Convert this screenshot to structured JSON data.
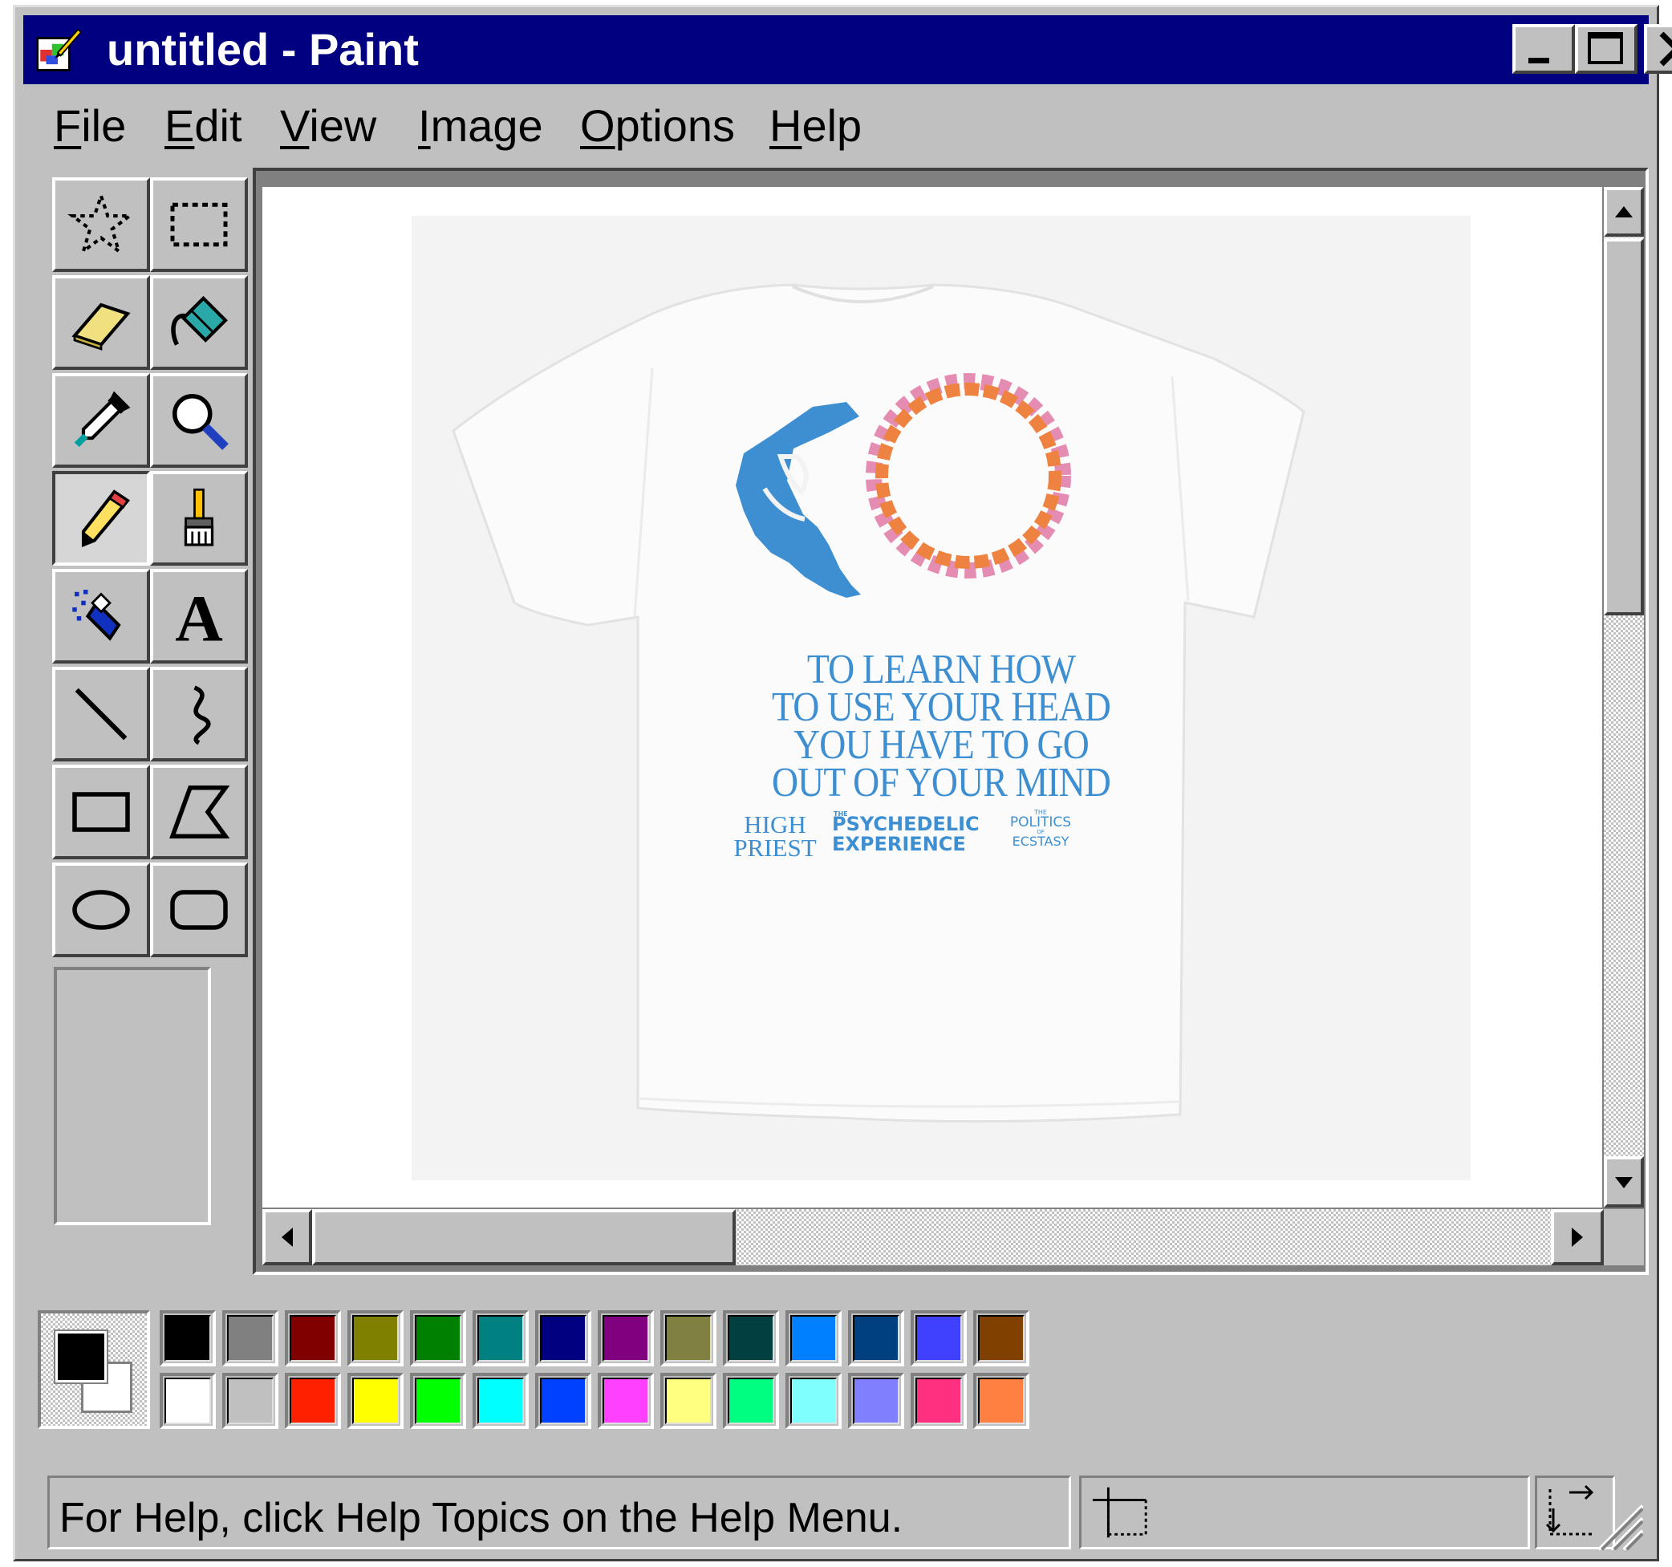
{
  "window": {
    "title": "untitled - Paint",
    "app_icon": "paint-app-icon",
    "controls": [
      "minimize-icon",
      "maximize-icon",
      "close-icon"
    ]
  },
  "menubar": {
    "items": [
      {
        "label": "File",
        "mnemonic": "F"
      },
      {
        "label": "Edit",
        "mnemonic": "E"
      },
      {
        "label": "View",
        "mnemonic": "V"
      },
      {
        "label": "Image",
        "mnemonic": "I"
      },
      {
        "label": "Options",
        "mnemonic": "O"
      },
      {
        "label": "Help",
        "mnemonic": "H"
      }
    ]
  },
  "toolbox": {
    "tools": [
      {
        "name": "free-form-select-icon"
      },
      {
        "name": "rectangle-select-icon"
      },
      {
        "name": "eraser-icon"
      },
      {
        "name": "fill-with-color-icon"
      },
      {
        "name": "pick-color-icon"
      },
      {
        "name": "magnifier-icon"
      },
      {
        "name": "pencil-icon",
        "selected": true
      },
      {
        "name": "brush-icon"
      },
      {
        "name": "airbrush-icon"
      },
      {
        "name": "text-icon"
      },
      {
        "name": "line-icon"
      },
      {
        "name": "curve-icon"
      },
      {
        "name": "rectangle-icon"
      },
      {
        "name": "polygon-icon"
      },
      {
        "name": "ellipse-icon"
      },
      {
        "name": "rounded-rectangle-icon"
      }
    ]
  },
  "canvas_image": {
    "quote": [
      "TO LEARN HOW",
      "TO USE YOUR HEAD",
      "YOU HAVE TO GO",
      "OUT OF YOUR MIND"
    ],
    "book1": [
      "HIGH",
      "PRIEST"
    ],
    "book2": {
      "small": "THE",
      "lines": [
        "PSYCHEDELIC",
        "EXPERIENCE"
      ]
    },
    "book3": {
      "small_top": "THE",
      "line1": "POLITICS",
      "small_mid": "OF",
      "line2": "ECSTASY"
    },
    "colors": {
      "print_blue": "#3d8fd1",
      "ring_orange": "#ee8241",
      "ring_pink": "#e58cb2"
    }
  },
  "palette": {
    "foreground": "#000000",
    "background": "#ffffff",
    "top_row": [
      "#000000",
      "#808080",
      "#800000",
      "#808000",
      "#008000",
      "#008080",
      "#000080",
      "#800080",
      "#808040",
      "#004040",
      "#0080ff",
      "#004080",
      "#4040ff",
      "#804000"
    ],
    "bottom_row": [
      "#ffffff",
      "#c0c0c0",
      "#ff2000",
      "#ffff00",
      "#00ff00",
      "#00ffff",
      "#0040ff",
      "#ff40ff",
      "#ffff80",
      "#00ff80",
      "#80ffff",
      "#8080ff",
      "#ff3080",
      "#ff8040"
    ]
  },
  "statusbar": {
    "help_text": "For Help, click Help Topics on the Help Menu."
  }
}
